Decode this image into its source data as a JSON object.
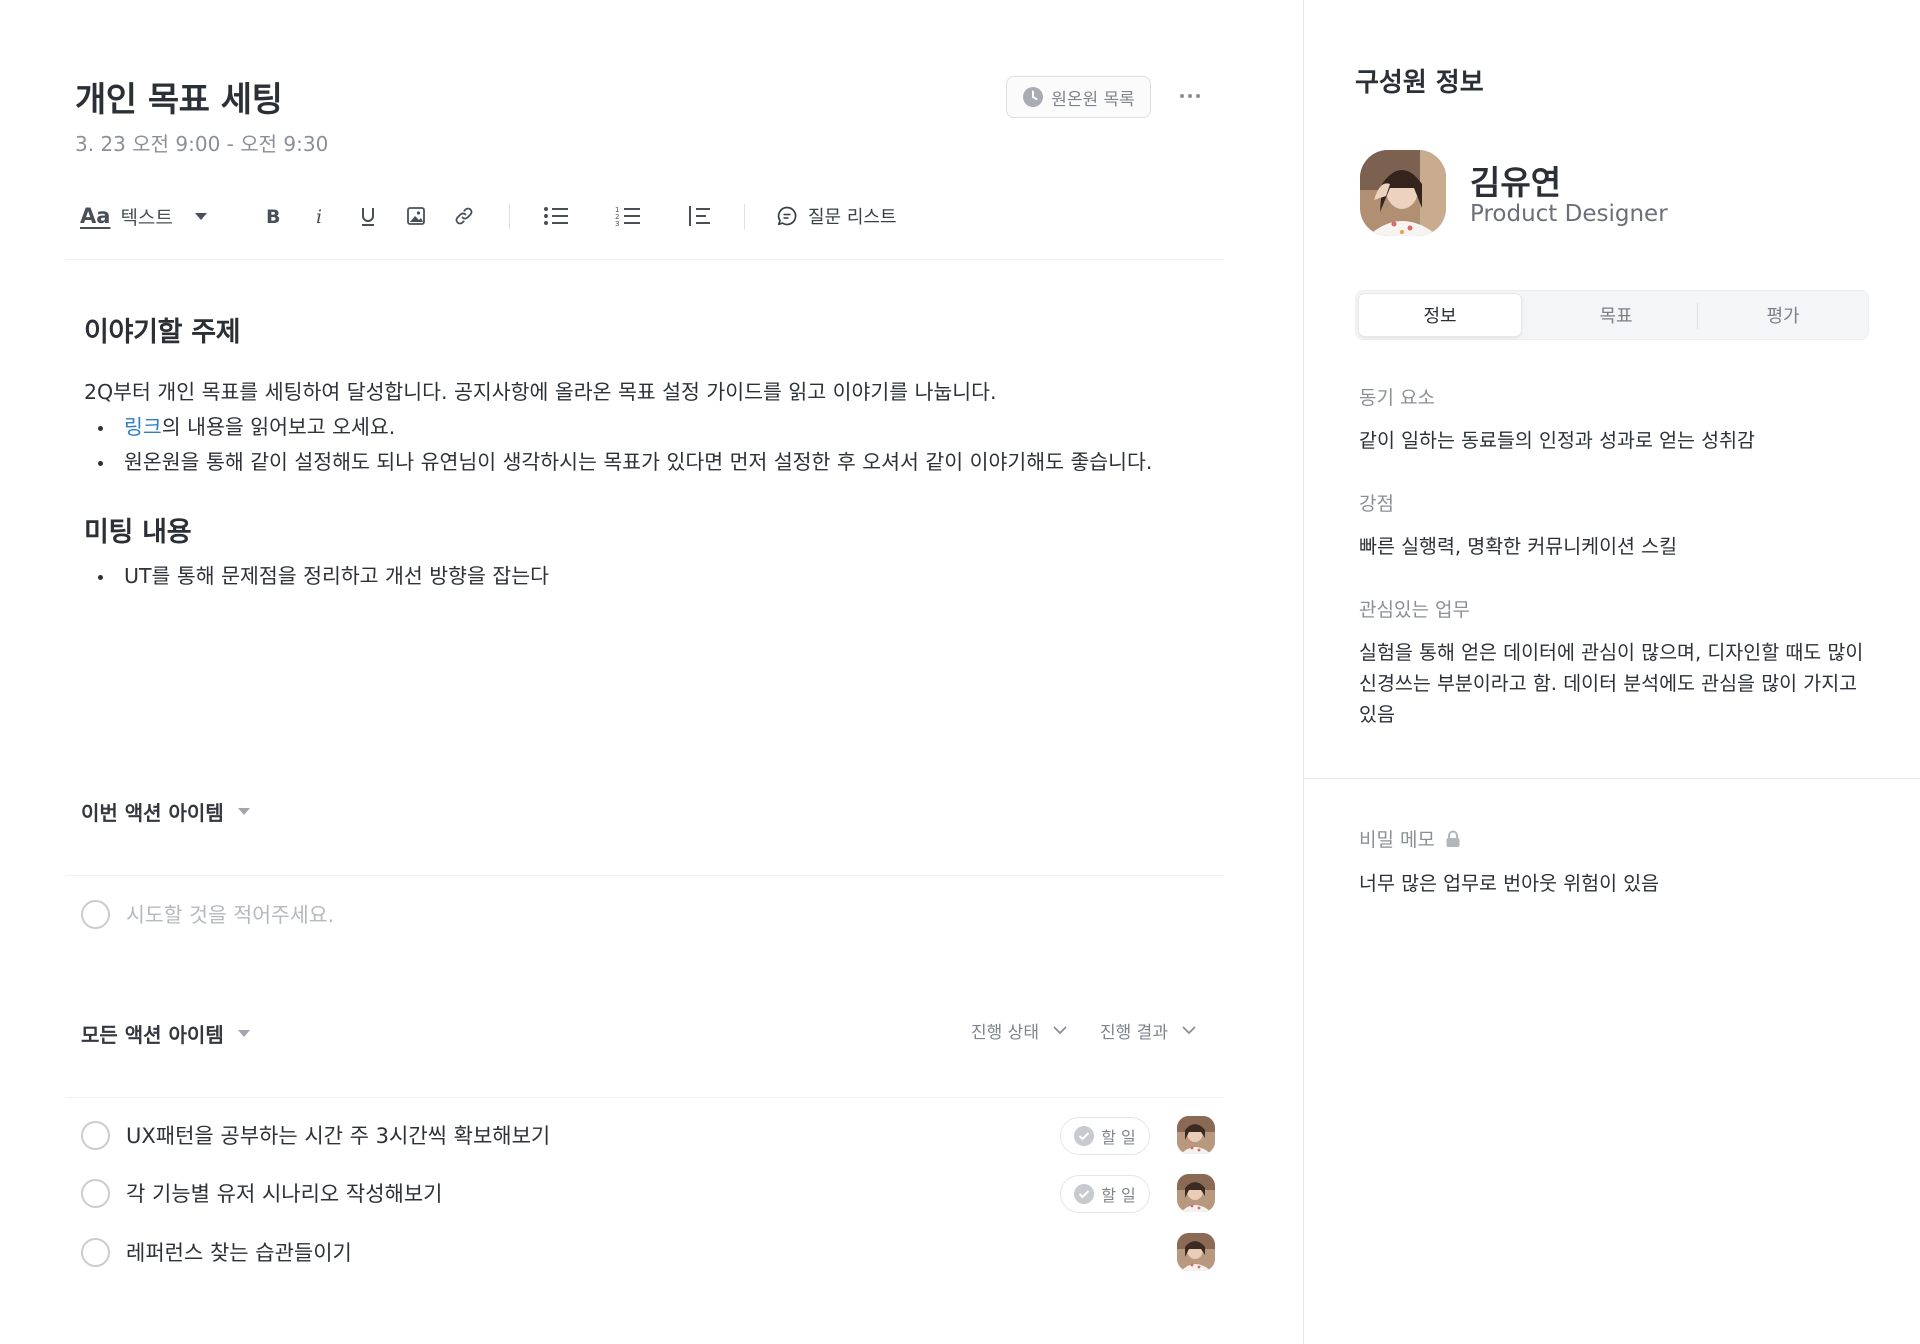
{
  "meeting": {
    "title": "개인 목표 세팅",
    "time": "3. 23 오전 9:00 - 오전 9:30",
    "oneone_list_label": "원온원 목록"
  },
  "toolbar": {
    "text_style_icon": "Aa",
    "text_style_label": "텍스트",
    "question_list_label": "질문 리스트",
    "icons": [
      "bold-icon",
      "italic-icon",
      "underline-icon",
      "image-icon",
      "link-icon",
      "bulleted-list-icon",
      "numbered-list-icon",
      "quote-icon",
      "comment-icon"
    ]
  },
  "content": {
    "topic_heading": "이야기할 주제",
    "topic_paragraph": "2Q부터 개인 목표를 세팅하여 달성합니다. 공지사항에 올라온 목표 설정 가이드를 읽고 이야기를 나눕니다.",
    "topic_bullets": [
      {
        "link": "링크",
        "text": "의 내용을 읽어보고 오세요."
      },
      {
        "text": "원온원을 통해 같이 설정해도 되나 유연님이 생각하시는 목표가 있다면 먼저 설정한 후 오셔서 같이 이야기해도 좋습니다."
      }
    ],
    "meeting_heading": "미팅 내용",
    "meeting_bullets": [
      "UT를 통해 문제점을 정리하고 개선 방향을 잡는다"
    ]
  },
  "current_actions": {
    "heading": "이번 액션 아이템",
    "input_placeholder": "시도할 것을 적어주세요."
  },
  "all_actions": {
    "heading": "모든 액션 아이템",
    "filter_status": "진행 상태",
    "filter_result": "진행 결과",
    "items": [
      {
        "label": "UX패턴을 공부하는 시간 주 3시간씩 확보해보기",
        "badge": "할 일"
      },
      {
        "label": "각 기능별 유저 시나리오 작성해보기",
        "badge": "할 일"
      },
      {
        "label": "레퍼런스 찾는 습관들이기",
        "badge": null
      }
    ]
  },
  "member": {
    "panel_title": "구성원 정보",
    "name": "김유연",
    "role": "Product Designer",
    "tabs": [
      "정보",
      "목표",
      "평가"
    ],
    "active_tab": "정보",
    "fields": [
      {
        "label": "동기 요소",
        "value": "같이 일하는 동료들의 인정과 성과로 얻는 성취감"
      },
      {
        "label": "강점",
        "value": "빠른 실행력, 명확한 커뮤니케이션 스킬"
      },
      {
        "label": "관심있는 업무",
        "value": "실험을 통해 얻은 데이터에 관심이 많으며, 디자인할 때도 많이 신경쓰는 부분이라고 함. 데이터 분석에도 관심을 많이 가지고 있음"
      }
    ],
    "secret_memo": {
      "label": "비밀 메모",
      "value": "너무 많은 업무로 번아웃 위험이 있음"
    }
  },
  "colors": {
    "link": "#2f7dc2",
    "text": "#2d3138",
    "muted": "#8b9097",
    "border": "#e6e8eb"
  }
}
